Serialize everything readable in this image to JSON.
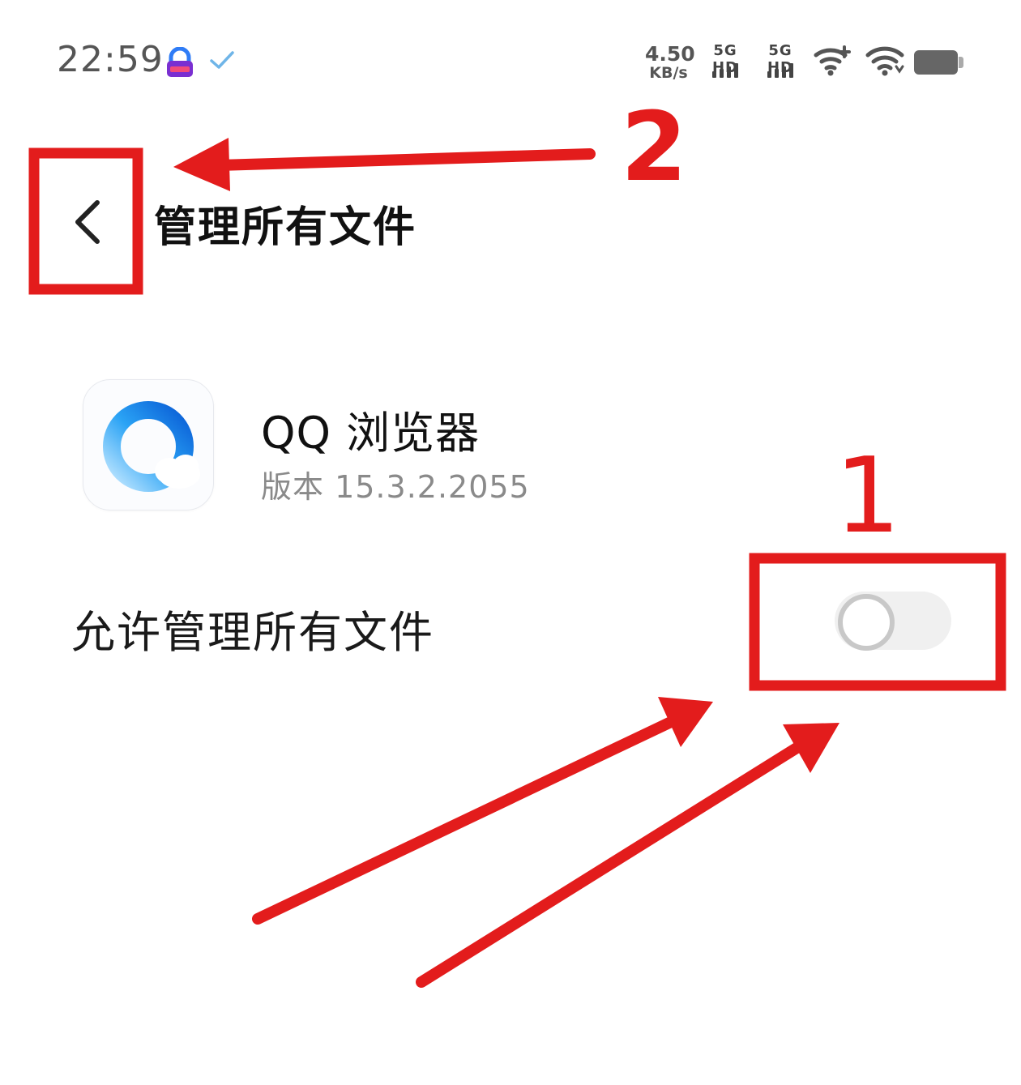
{
  "status_bar": {
    "time": "22:59",
    "net_speed_value": "4.50",
    "net_speed_unit": "KB/s",
    "sim1_label": "5G HD",
    "sim2_label": "5G HD",
    "icons": [
      "app-lock-icon",
      "check-icon",
      "signal-icon",
      "wifi-plus-icon",
      "wifi-icon",
      "battery-icon"
    ]
  },
  "header": {
    "back_icon": "chevron-left-icon",
    "title": "管理所有文件"
  },
  "app": {
    "name": "QQ 浏览器",
    "version": "版本 15.3.2.2055",
    "icon": "qq-browser-icon"
  },
  "setting": {
    "label": "允许管理所有文件",
    "enabled": false
  },
  "annotations": {
    "color": "#e31c1c",
    "marks": [
      {
        "number": "1",
        "target": "allow-manage-switch"
      },
      {
        "number": "2",
        "target": "back-button"
      }
    ]
  },
  "colors": {
    "accent_red": "#e31c1c",
    "switch_off_track": "#f0f0f0",
    "switch_off_knob_border": "#c8c8c8",
    "secondary_text": "#8a8a8a"
  }
}
